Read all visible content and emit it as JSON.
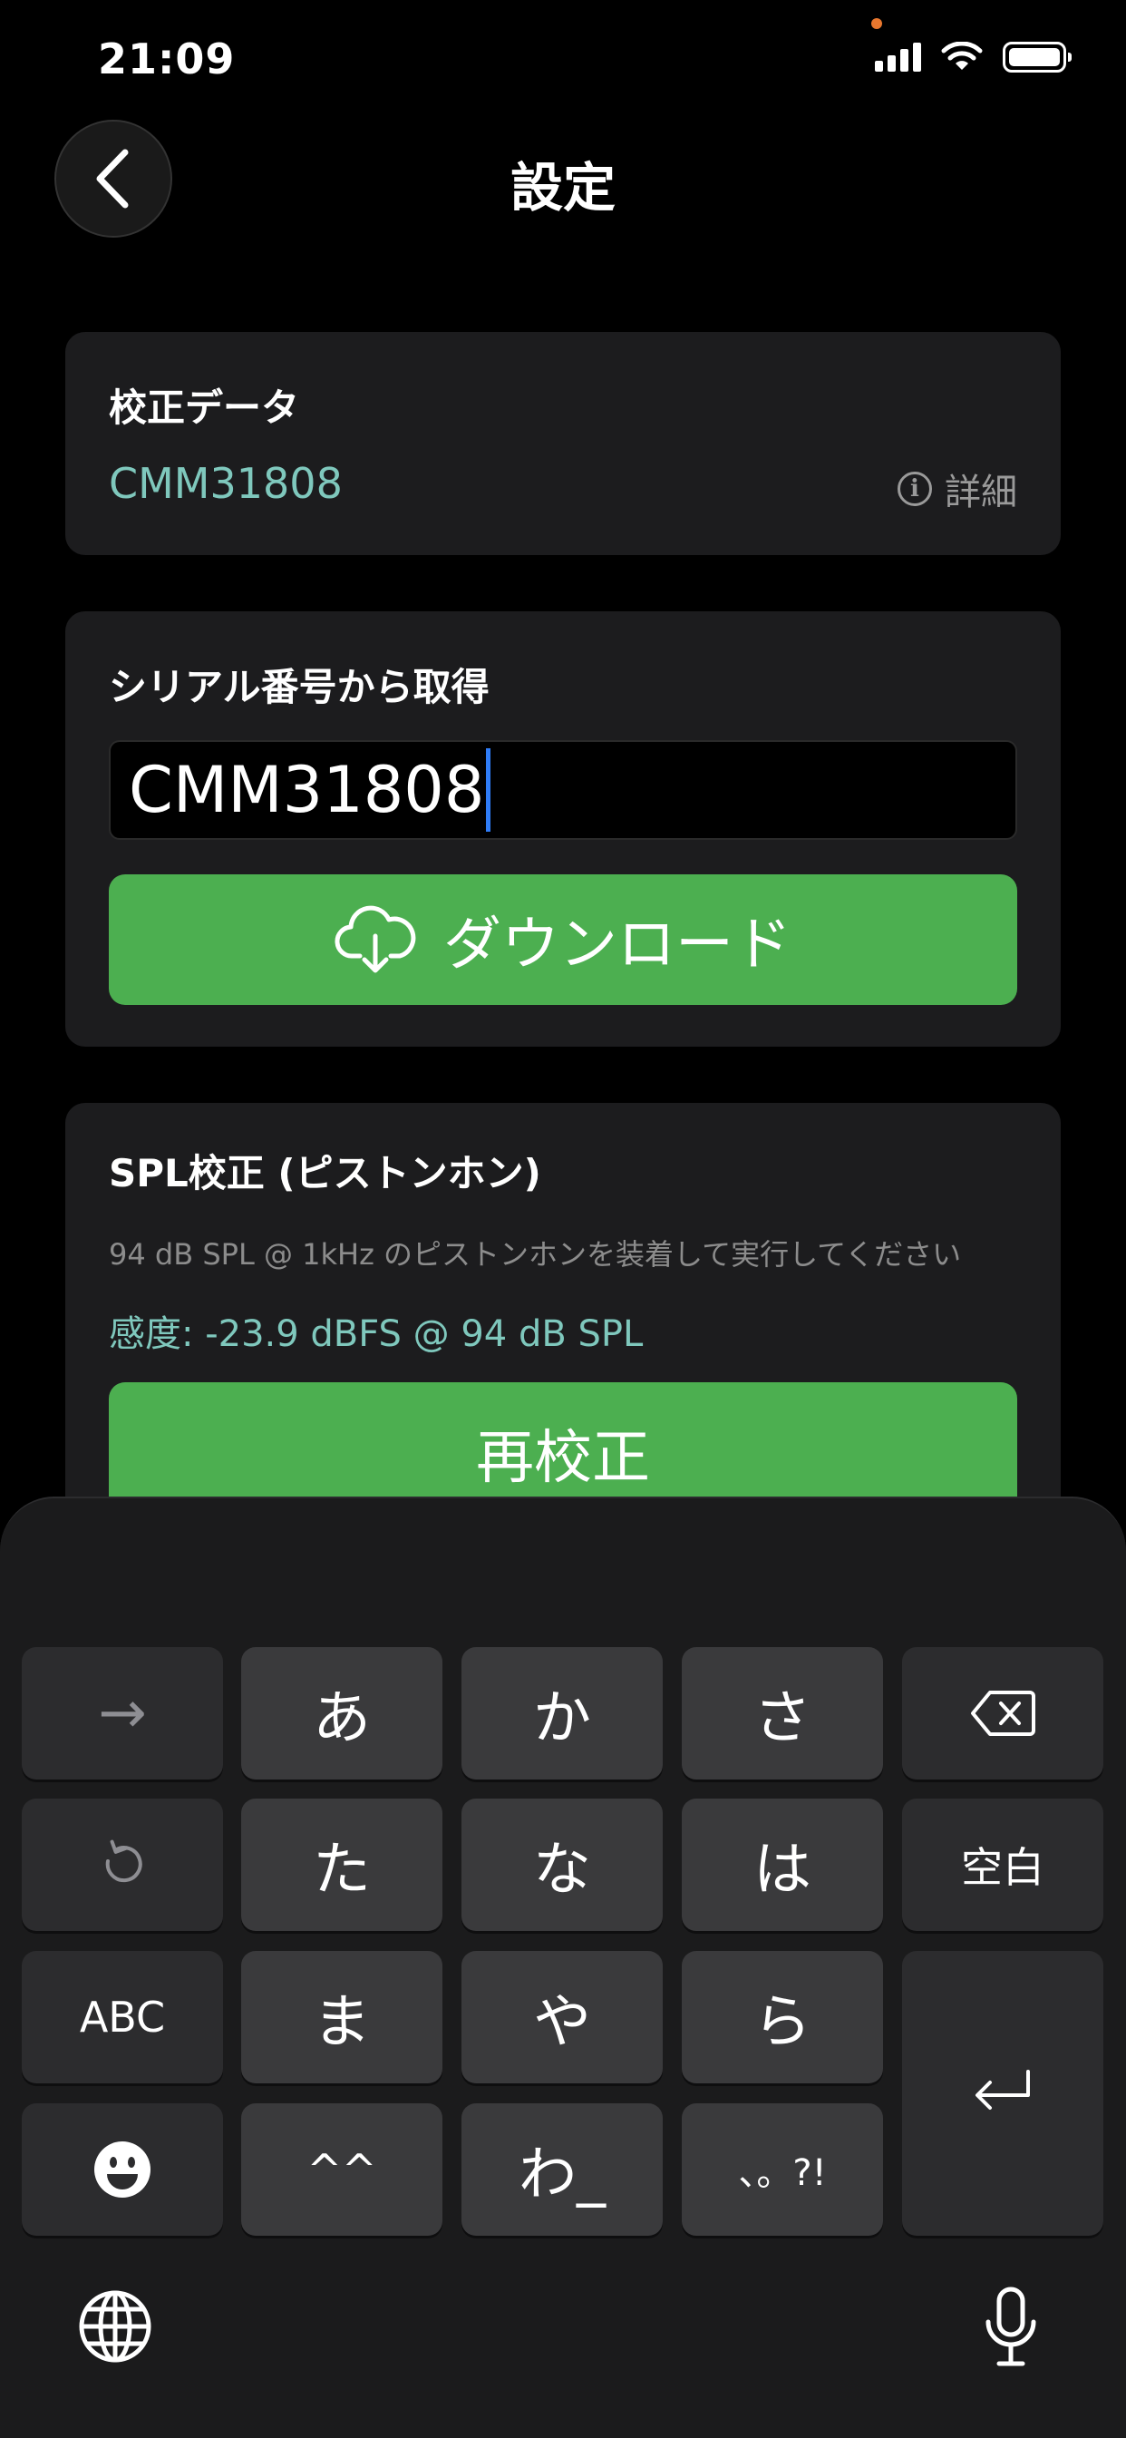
{
  "status_bar": {
    "time": "21:09",
    "privacy_dot_color": "#e8772e",
    "icons": [
      "signal-icon",
      "wifi-icon",
      "battery-icon"
    ]
  },
  "header": {
    "title": "設定",
    "back_icon": "chevron-left-icon"
  },
  "calibration_card": {
    "title": "校正データ",
    "value": "CMM31808",
    "details_label": "詳細",
    "details_icon": "info-icon"
  },
  "serial_card": {
    "title": "シリアル番号から取得",
    "input_value": "CMM31808",
    "download_label": "ダウンロード",
    "download_icon": "cloud-download-icon"
  },
  "spl_card": {
    "title": "SPL校正 (ピストンホン)",
    "description": "94 dB SPL @ 1kHz のピストンホンを装着して実行してください",
    "sensitivity": "感度: -23.9 dBFS @ 94 dB SPL",
    "recalibrate_label": "再校正"
  },
  "keyboard": {
    "row1": [
      "→",
      "あ",
      "か",
      "さ",
      "⌫"
    ],
    "row2": [
      "↺",
      "た",
      "な",
      "は",
      "空白"
    ],
    "row3": [
      "ABC",
      "ま",
      "や",
      "ら"
    ],
    "row4": [
      "☺",
      "^^",
      "わ_",
      "、。?!"
    ],
    "return_icon": "return-icon",
    "globe_icon": "globe-icon",
    "mic_icon": "microphone-icon"
  },
  "colors": {
    "accent_green": "#4caf50",
    "teal_text": "#7fc8bd",
    "caret_blue": "#2f7cf6"
  }
}
